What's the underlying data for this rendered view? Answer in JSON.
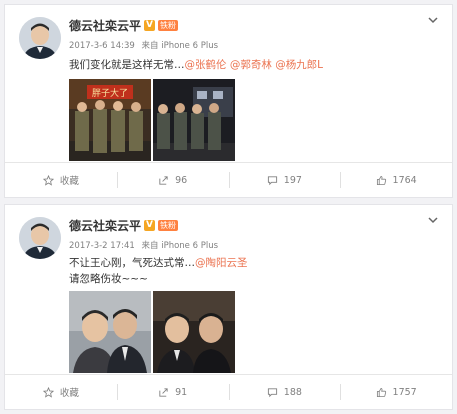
{
  "posts": [
    {
      "username": "德云社栾云平",
      "v_badge": "V",
      "fan_badge": "铁粉",
      "timestamp": "2017-3-6 14:39",
      "source_prefix": "来自",
      "source": "iPhone 6 Plus",
      "text_main": "我们变化就是这样无常…",
      "mentions": [
        "@张鹤伦",
        "@郭奇林",
        "@杨九郎L"
      ],
      "image_sign_text": "胖子大了",
      "favorite_label": "收藏",
      "reposts": "96",
      "comments": "197",
      "likes": "1764"
    },
    {
      "username": "德云社栾云平",
      "v_badge": "V",
      "fan_badge": "铁粉",
      "timestamp": "2017-3-2 17:41",
      "source_prefix": "来自",
      "source": "iPhone 6 Plus",
      "text_main": "不让王心刚，气死达式常…",
      "mentions": [
        "@陶阳云圣"
      ],
      "text_line2": "请忽略伤妆~~~",
      "favorite_label": "收藏",
      "reposts": "91",
      "comments": "188",
      "likes": "1757"
    }
  ],
  "icons": {
    "more": "chevron-down-icon",
    "favorite": "star-icon",
    "repost": "repost-icon",
    "comment": "comment-icon",
    "like": "thumbs-up-icon"
  },
  "colors": {
    "mention": "#eb7350",
    "meta": "#808080",
    "background": "#f2f2f5",
    "verified_badge": "#f5a623",
    "fan_badge": "#ff8140"
  }
}
